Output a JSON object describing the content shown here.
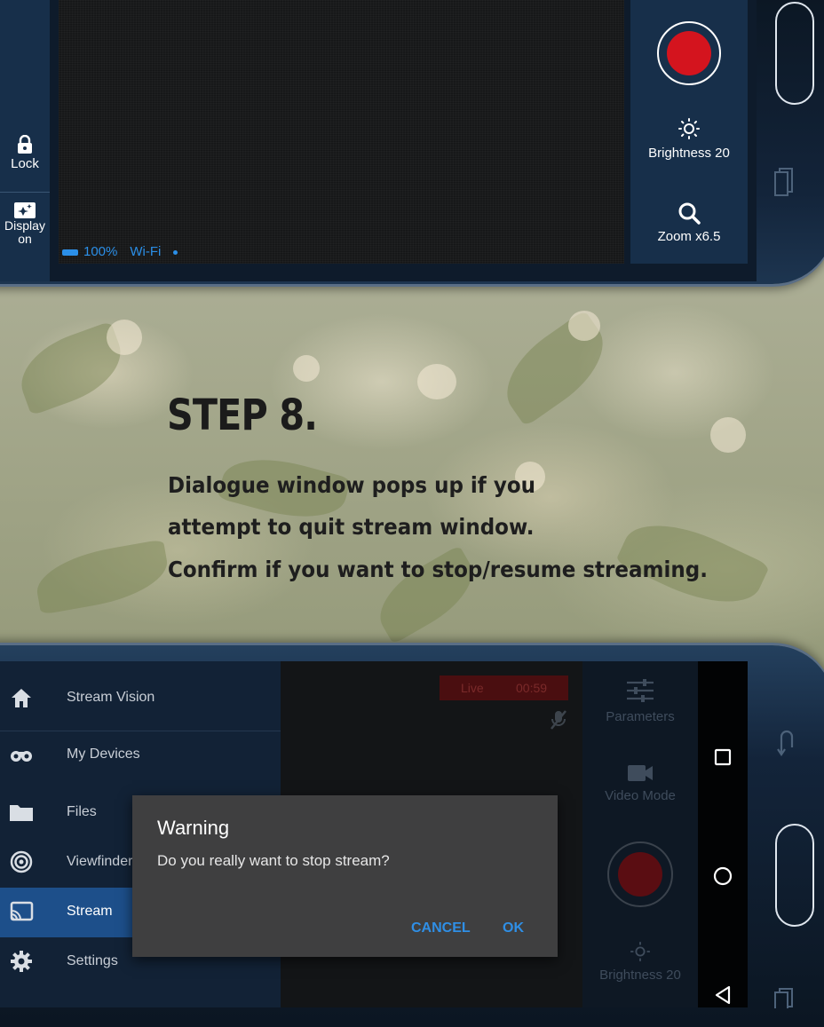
{
  "top_screen": {
    "lock_label": "Lock",
    "display_label_1": "Display",
    "display_label_2": "on",
    "battery": "100%",
    "connection": "Wi-Fi",
    "brightness_label": "Brightness 20",
    "zoom_label": "Zoom x6.5"
  },
  "instructions": {
    "step_title": "STEP 8.",
    "line1": "Dialogue window pops up if you",
    "line2": "attempt to quit stream window.",
    "line3": "Confirm if you want to stop/resume streaming."
  },
  "bottom_screen": {
    "menu": {
      "header": "Stream Vision",
      "items": [
        {
          "label": "My Devices",
          "icon": "binoculars-icon",
          "active": false
        },
        {
          "label": "Files",
          "icon": "folder-icon",
          "active": false
        },
        {
          "label": "Viewfinder",
          "icon": "viewfinder-icon",
          "active": false
        },
        {
          "label": "Stream",
          "icon": "cast-icon",
          "active": true
        },
        {
          "label": "Settings",
          "icon": "gear-icon",
          "active": false
        }
      ]
    },
    "live": {
      "label": "Live",
      "time": "00:59"
    },
    "parameters_label": "Parameters",
    "video_mode_label": "Video Mode",
    "brightness_label": "Brightness 20"
  },
  "dialog": {
    "title": "Warning",
    "message": "Do you really want to stop stream?",
    "cancel_label": "CANCEL",
    "ok_label": "OK"
  },
  "colors": {
    "accent": "#2f8fe6",
    "record": "#d4141e",
    "active_menu": "#1d4f8a"
  }
}
